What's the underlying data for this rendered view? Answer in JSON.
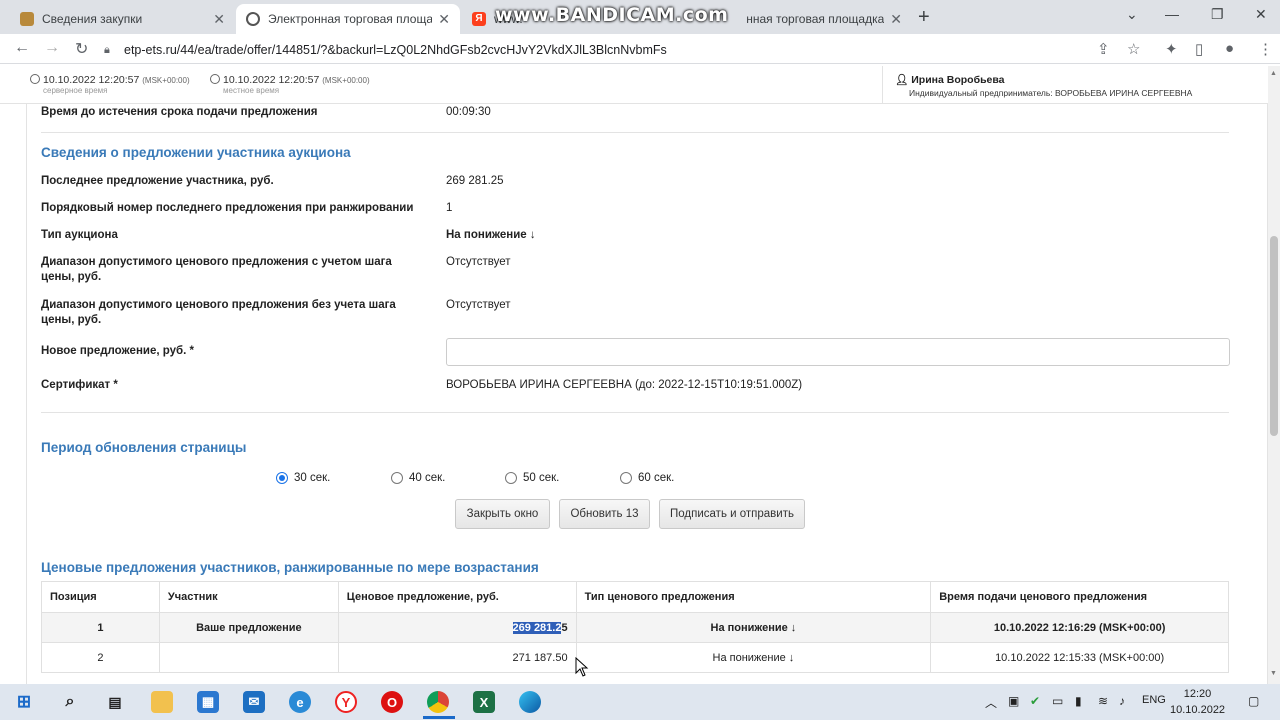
{
  "browser": {
    "tabs": [
      {
        "title": "Сведения закупки",
        "active": false
      },
      {
        "title": "Электронная торговая площадка",
        "active": true
      },
      {
        "title": "www.",
        "active": false
      },
      {
        "title": "нная торговая площадка",
        "active": false
      }
    ],
    "watermark": "www.BANDICAM.com",
    "url": "etp-ets.ru/44/ea/trade/offer/144851/?&backurl=LzQ0L2NhdGFsb2cvcHJvY2VkdXJlL3BlcnNvbmFs"
  },
  "header": {
    "server_time": "10.10.2022 12:20:57",
    "server_zone": "(MSK+00:00)",
    "server_caption": "серверное время",
    "local_time": "10.10.2022 12:20:57",
    "local_zone": "(MSK+00:00)",
    "local_caption": "местное время",
    "user_name": "Ирина Воробьева",
    "user_desc": "Индивидуальный предприниматель: ВОРОБЬЕВА ИРИНА СЕРГЕЕВНА"
  },
  "deadline": {
    "label": "Время до истечения срока подачи предложения",
    "value": "00:09:30"
  },
  "offer_section": {
    "title": "Сведения о предложении участника аукциона",
    "rows": [
      {
        "label": "Последнее предложение участника, руб.",
        "value": "269 281.25"
      },
      {
        "label": "Порядковый номер последнего предложения при ранжировании",
        "value": "1"
      },
      {
        "label": "Тип аукциона",
        "value": "На понижение ↓"
      },
      {
        "label": "Диапазон допустимого ценового предложения с учетом шага цены, руб.",
        "value": "Отсутствует"
      },
      {
        "label": "Диапазон допустимого ценового предложения без учета шага цены, руб.",
        "value": "Отсутствует"
      }
    ],
    "new_offer_label": "Новое предложение, руб. *",
    "new_offer_value": "",
    "certificate_label": "Сертификат *",
    "certificate_value": "ВОРОБЬЕВА ИРИНА СЕРГЕЕВНА (до: 2022-12-15T10:19:51.000Z)"
  },
  "refresh_section": {
    "title": "Период обновления страницы",
    "options": [
      "30 сек.",
      "40 сек.",
      "50 сек.",
      "60 сек."
    ],
    "selected": "30 сек."
  },
  "buttons": {
    "close": "Закрыть окно",
    "refresh": "Обновить 13",
    "sign": "Подписать и отправить"
  },
  "bids": {
    "title": "Ценовые предложения участников, ранжированные по мере возрастания",
    "headers": [
      "Позиция",
      "Участник",
      "Ценовое предложение, руб.",
      "Тип ценового предложения",
      "Время подачи ценового предложения"
    ],
    "rows": [
      {
        "position": "1",
        "participant": "Ваше предложение",
        "price_selected": "269 281.2",
        "price_rest": "5",
        "type": "На понижение ↓",
        "time": "10.10.2022 12:16:29 (MSK+00:00)"
      },
      {
        "position": "2",
        "participant": "",
        "price": "271 187.50",
        "type": "На понижение ↓",
        "time": "10.10.2022 12:15:33 (MSK+00:00)"
      }
    ]
  },
  "taskbar": {
    "lang": "ENG",
    "time": "12:20",
    "date": "10.10.2022"
  }
}
